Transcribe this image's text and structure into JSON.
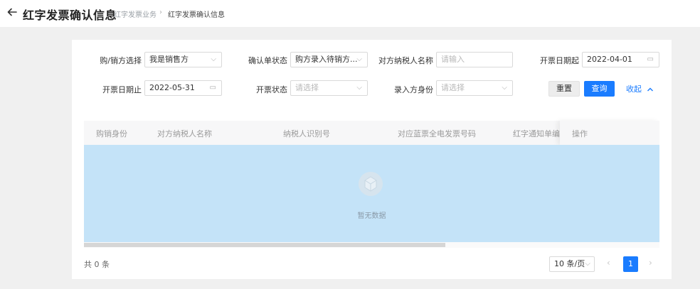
{
  "header": {
    "title": "红字发票确认信息",
    "breadcrumb": [
      "红字发票业务",
      "红字发票确认信息"
    ],
    "breadcrumb_sep": "›"
  },
  "filters": {
    "buyer_seller": {
      "label": "购/销方选择",
      "value": "我是销售方"
    },
    "confirm_status": {
      "label": "确认单状态",
      "value": "购方录入待销方..."
    },
    "counterparty_name": {
      "label": "对方纳税人名称",
      "placeholder": "请输入"
    },
    "issue_date_start": {
      "label": "开票日期起",
      "value": "2022-04-01"
    },
    "issue_date_end": {
      "label": "开票日期止",
      "value": "2022-05-31"
    },
    "invoice_status": {
      "label": "开票状态",
      "placeholder": "请选择"
    },
    "entry_identity": {
      "label": "录入方身份",
      "placeholder": "请选择"
    }
  },
  "actions": {
    "reset_label": "重置",
    "query_label": "查询",
    "collapse_label": "收起"
  },
  "table": {
    "columns": [
      "购销身份",
      "对方纳税人名称",
      "纳税人识别号",
      "对应蓝票全电发票号码",
      "红字通知单编号",
      "操作"
    ],
    "rows": [],
    "empty_text": "暂无数据"
  },
  "pagination": {
    "total_text": "共 0 条",
    "page_size": "10 条/页",
    "current_page": "1"
  },
  "colors": {
    "primary": "#1a7cff",
    "empty_body": "#c4e3f8"
  }
}
